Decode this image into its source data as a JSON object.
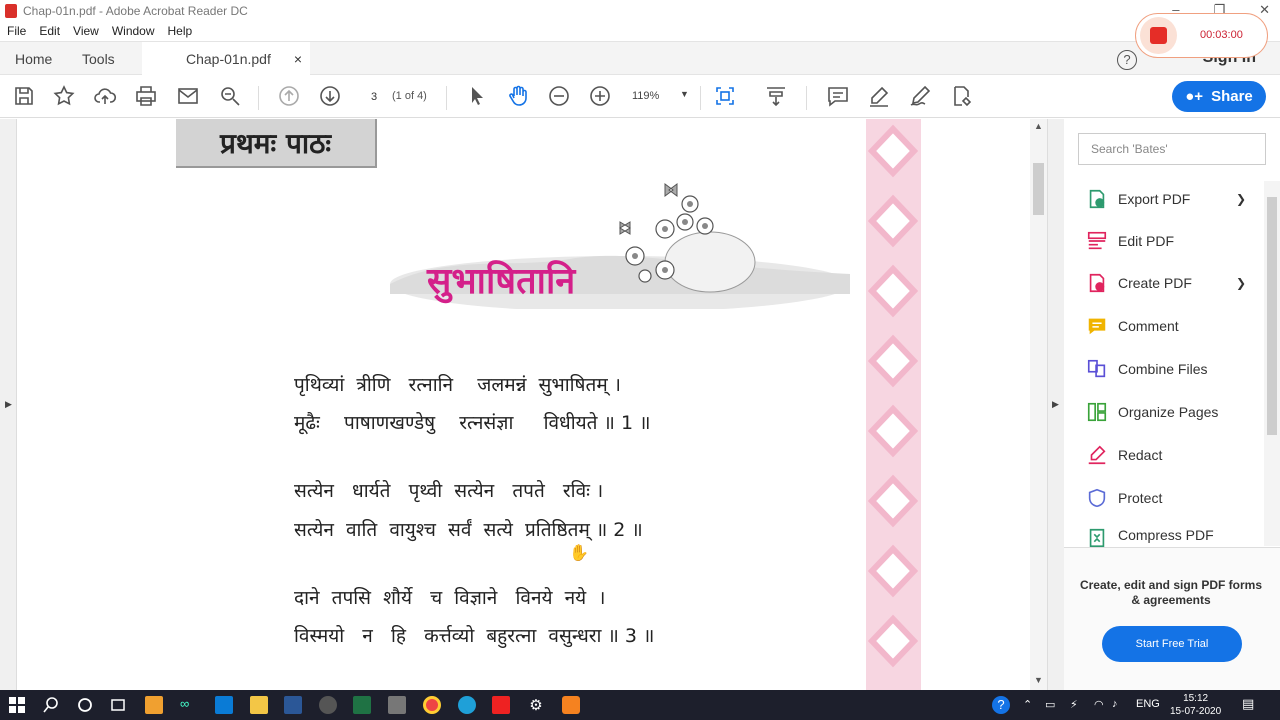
{
  "window": {
    "title": "Chap-01n.pdf - Adobe Acrobat Reader DC"
  },
  "menu": [
    "File",
    "Edit",
    "View",
    "Window",
    "Help"
  ],
  "tabs": {
    "home": "Home",
    "tools": "Tools",
    "doc": "Chap-01n.pdf",
    "close": "×"
  },
  "header": {
    "sign_in": "Sign In",
    "help": "?"
  },
  "toolbar": {
    "page_current": "3",
    "page_count": "(1 of 4)",
    "zoom": "119%",
    "share": "Share"
  },
  "recorder": {
    "time": "00:03:00"
  },
  "document": {
    "chapter": "प्रथमः पाठः",
    "title": "सुभाषितानि",
    "verses": [
      "पृथिव्यां  त्रीणि   रत्नानि    जलमन्नं  सुभाषितम् ।",
      "मूढैः    पाषाणखण्डेषु    रत्नसंज्ञा     विधीयते ॥ 1 ॥",
      "सत्येन   धार्यते   पृथ्वी  सत्येन   तपते   रविः ।",
      "सत्येन  वाति  वायुश्च  सर्वं  सत्ये  प्रतिष्ठितम् ॥ 2 ॥",
      "दाने  तपसि  शौर्ये   च  विज्ञाने   विनये  नये  ।",
      "विस्मयो   न   हि   कर्त्तव्यो  बहुरत्ना  वसुन्धरा ॥ 3 ॥"
    ]
  },
  "right_pane": {
    "search_placeholder": "Search 'Bates'",
    "tools": [
      {
        "label": "Export PDF",
        "icon": "export-pdf-icon",
        "color": "#2d9a6e"
      },
      {
        "label": "Edit PDF",
        "icon": "edit-pdf-icon",
        "color": "#e0245e"
      },
      {
        "label": "Create PDF",
        "icon": "create-pdf-icon",
        "color": "#e0245e"
      },
      {
        "label": "Comment",
        "icon": "comment-icon",
        "color": "#f0b400"
      },
      {
        "label": "Combine Files",
        "icon": "combine-files-icon",
        "color": "#5a4fd6"
      },
      {
        "label": "Organize Pages",
        "icon": "organize-pages-icon",
        "color": "#3aa33a"
      },
      {
        "label": "Redact",
        "icon": "redact-icon",
        "color": "#e0245e"
      },
      {
        "label": "Protect",
        "icon": "protect-icon",
        "color": "#5b6bd6"
      },
      {
        "label": "Compress PDF",
        "icon": "compress-pdf-icon",
        "color": "#2d9a6e"
      }
    ],
    "promo_text": "Create, edit and sign PDF forms & agreements",
    "promo_button": "Start Free Trial"
  },
  "taskbar": {
    "lang": "ENG",
    "time": "15:12",
    "date": "15-07-2020"
  },
  "colors": {
    "accent": "#1473e6",
    "title_pink": "#d4208a"
  }
}
